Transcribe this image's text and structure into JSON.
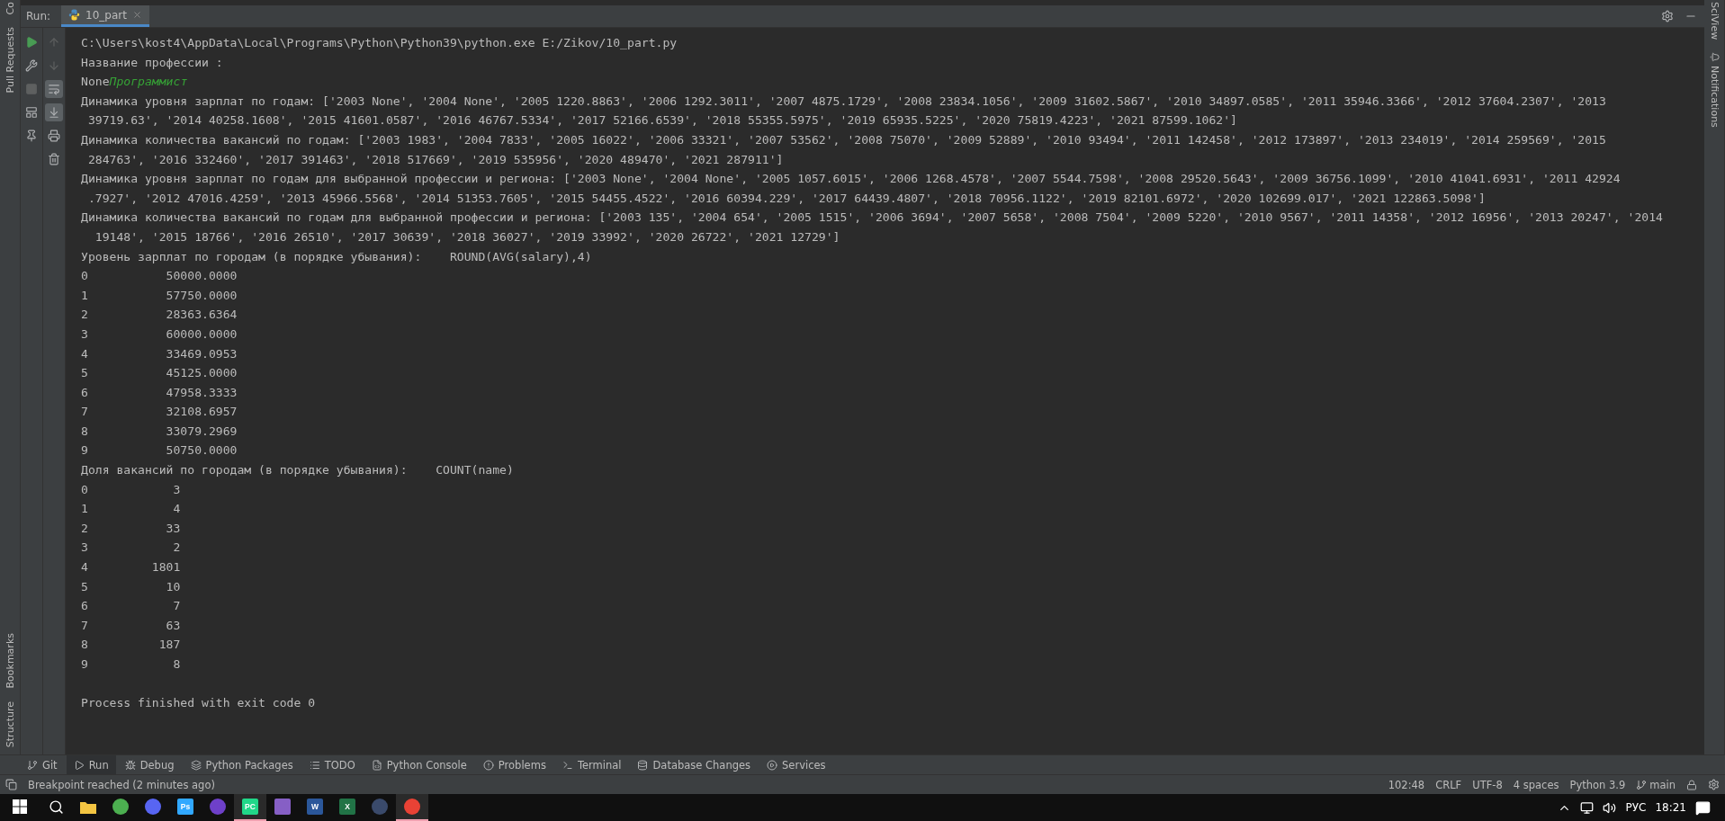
{
  "left_strip": {
    "top_label": "Co",
    "labels": [
      "Pull Requests"
    ],
    "bottom_labels": [
      "Bookmarks",
      "Structure"
    ]
  },
  "right_strip": {
    "labels": [
      "SciView",
      "Notifications"
    ]
  },
  "run_bar": {
    "label": "Run:",
    "tab": {
      "title": "10_part",
      "selected": true
    }
  },
  "toolbar_column_1": [
    {
      "disabled": false
    },
    {
      "disabled": false
    },
    {
      "disabled": true
    },
    {
      "disabled": false
    },
    {
      "disabled": false
    }
  ],
  "toolbar_column_2": [
    {
      "selected": false,
      "disabled": true
    },
    {
      "selected": false,
      "disabled": true
    },
    {
      "selected": true,
      "disabled": false
    },
    {
      "selected": true,
      "disabled": false
    },
    {
      "selected": false,
      "disabled": false
    },
    {
      "selected": false,
      "disabled": false
    }
  ],
  "console": {
    "lines": [
      {
        "kind": "text",
        "text": "C:\\Users\\kost4\\AppData\\Local\\Programs\\Python\\Python39\\python.exe E:/Zikov/10_part.py"
      },
      {
        "kind": "text",
        "text": "Название профессии :"
      },
      {
        "kind": "mixed",
        "segments": [
          {
            "kind": "output",
            "text": "None"
          },
          {
            "kind": "input",
            "text": "Программист"
          }
        ]
      },
      {
        "kind": "text",
        "text": "Динамика уровня зарплат по годам: ['2003 None', '2004 None', '2005 1220.8863', '2006 1292.3011', '2007 4875.1729', '2008 23834.1056', '2009 31602.5867', '2010 34897.0585', '2011 35946.3366', '2012 37604.2307', '2013"
      },
      {
        "kind": "text",
        "text": " 39719.63', '2014 40258.1608', '2015 41601.0587', '2016 46767.5334', '2017 52166.6539', '2018 55355.5975', '2019 65935.5225', '2020 75819.4223', '2021 87599.1062']"
      },
      {
        "kind": "text",
        "text": "Динамика количества вакансий по годам: ['2003 1983', '2004 7833', '2005 16022', '2006 33321', '2007 53562', '2008 75070', '2009 52889', '2010 93494', '2011 142458', '2012 173897', '2013 234019', '2014 259569', '2015"
      },
      {
        "kind": "text",
        "text": " 284763', '2016 332460', '2017 391463', '2018 517669', '2019 535956', '2020 489470', '2021 287911']"
      },
      {
        "kind": "text",
        "text": "Динамика уровня зарплат по годам для выбранной профессии и региона: ['2003 None', '2004 None', '2005 1057.6015', '2006 1268.4578', '2007 5544.7598', '2008 29520.5643', '2009 36756.1099', '2010 41041.6931', '2011 42924"
      },
      {
        "kind": "text",
        "text": " .7927', '2012 47016.4259', '2013 45966.5568', '2014 51353.7605', '2015 54455.4522', '2016 60394.229', '2017 64439.4807', '2018 70956.1122', '2019 82101.6972', '2020 102699.017', '2021 122863.5098']"
      },
      {
        "kind": "text",
        "text": "Динамика количества вакансий по годам для выбранной профессии и региона: ['2003 135', '2004 654', '2005 1515', '2006 3694', '2007 5658', '2008 7504', '2009 5220', '2010 9567', '2011 14358', '2012 16956', '2013 20247', '2014"
      },
      {
        "kind": "text",
        "text": "  19148', '2015 18766', '2016 26510', '2017 30639', '2018 36027', '2019 33992', '2020 26722', '2021 12729']"
      },
      {
        "kind": "text",
        "text": "Уровень зарплат по городам (в порядке убывания):    ROUND(AVG(salary),4)"
      },
      {
        "kind": "text",
        "text": "0           50000.0000"
      },
      {
        "kind": "text",
        "text": "1           57750.0000"
      },
      {
        "kind": "text",
        "text": "2           28363.6364"
      },
      {
        "kind": "text",
        "text": "3           60000.0000"
      },
      {
        "kind": "text",
        "text": "4           33469.0953"
      },
      {
        "kind": "text",
        "text": "5           45125.0000"
      },
      {
        "kind": "text",
        "text": "6           47958.3333"
      },
      {
        "kind": "text",
        "text": "7           32108.6957"
      },
      {
        "kind": "text",
        "text": "8           33079.2969"
      },
      {
        "kind": "text",
        "text": "9           50750.0000"
      },
      {
        "kind": "text",
        "text": "Доля вакансий по городам (в порядке убывания):    COUNT(name)"
      },
      {
        "kind": "text",
        "text": "0            3"
      },
      {
        "kind": "text",
        "text": "1            4"
      },
      {
        "kind": "text",
        "text": "2           33"
      },
      {
        "kind": "text",
        "text": "3            2"
      },
      {
        "kind": "text",
        "text": "4         1801"
      },
      {
        "kind": "text",
        "text": "5           10"
      },
      {
        "kind": "text",
        "text": "6            7"
      },
      {
        "kind": "text",
        "text": "7           63"
      },
      {
        "kind": "text",
        "text": "8          187"
      },
      {
        "kind": "text",
        "text": "9            8"
      },
      {
        "kind": "blank"
      },
      {
        "kind": "text",
        "text": "Process finished with exit code 0"
      }
    ]
  },
  "bottom_tabs": [
    {
      "label": "Git",
      "selected": false
    },
    {
      "label": "Run",
      "selected": true
    },
    {
      "label": "Debug",
      "selected": false
    },
    {
      "label": "Python Packages",
      "selected": false
    },
    {
      "label": "TODO",
      "selected": false
    },
    {
      "label": "Python Console",
      "selected": false
    },
    {
      "label": "Problems",
      "selected": false
    },
    {
      "label": "Terminal",
      "selected": false
    },
    {
      "label": "Database Changes",
      "selected": false
    },
    {
      "label": "Services",
      "selected": false
    }
  ],
  "status_bar": {
    "message": "Breakpoint reached (2 minutes ago)",
    "items": [
      "102:48",
      "CRLF",
      "UTF-8",
      "4 spaces",
      "Python 3.9",
      "main"
    ]
  },
  "taskbar": {
    "apps": [
      {
        "kind": "folder",
        "color": "#f4c542",
        "selected": false
      },
      {
        "kind": "circle",
        "color": "#4caf50",
        "selected": false
      },
      {
        "kind": "circle",
        "color": "#5865f2",
        "selected": false
      },
      {
        "kind": "square",
        "color": "#31a8ff",
        "label": "Ps",
        "selected": false
      },
      {
        "kind": "circle",
        "color": "#6e40c9",
        "selected": false
      },
      {
        "kind": "square",
        "color": "#21d789",
        "label": "PC",
        "selected": true
      },
      {
        "kind": "square",
        "color": "#865fc5",
        "selected": false
      },
      {
        "kind": "square",
        "color": "#2b579a",
        "label": "W",
        "selected": false
      },
      {
        "kind": "square",
        "color": "#217346",
        "label": "X",
        "selected": false
      },
      {
        "kind": "circle",
        "color": "#3a4a6b",
        "selected": false
      },
      {
        "kind": "circle",
        "color": "#e94235",
        "selected": true
      }
    ],
    "language": "РУС",
    "time": "18:21"
  }
}
